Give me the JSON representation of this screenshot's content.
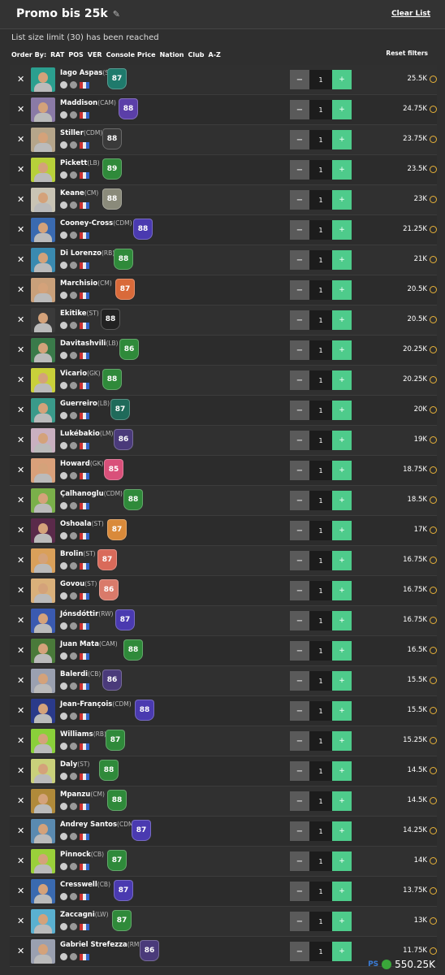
{
  "header": {
    "title": "Promo bis 25k",
    "clear_label": "Clear List"
  },
  "limit_text": "List size limit (30) has been reached",
  "order": {
    "label": "Order By:",
    "options": [
      "RAT",
      "POS",
      "VER",
      "Console Price",
      "Nation",
      "Club",
      "A-Z"
    ],
    "reset_label": "Reset filters"
  },
  "colors": {
    "plus": "#4ecb8b",
    "minus": "#5a5a5a",
    "coin": "#e8b33a"
  },
  "players": [
    {
      "name": "Iago Aspas",
      "pos": "(ST)",
      "rating": "87",
      "qty": "1",
      "price": "25.5K",
      "card": "#1f7a6c",
      "photo": "#2b9f8f"
    },
    {
      "name": "Maddison",
      "pos": "(CAM)",
      "rating": "88",
      "qty": "1",
      "price": "24.75K",
      "card": "#5b3fa8",
      "photo": "#8a7aa6"
    },
    {
      "name": "Stiller",
      "pos": "(CDM)",
      "rating": "88",
      "qty": "1",
      "price": "23.75K",
      "card": "#3a3a3a",
      "photo": "#b5a58a"
    },
    {
      "name": "Pickett",
      "pos": "(LB)",
      "rating": "89",
      "qty": "1",
      "price": "23.5K",
      "card": "#2f8a3a",
      "photo": "#b7d03a"
    },
    {
      "name": "Keane",
      "pos": "(CM)",
      "rating": "88",
      "qty": "1",
      "price": "23K",
      "card": "#8a8a7a",
      "photo": "#c9c4b4"
    },
    {
      "name": "Cooney-Cross",
      "pos": "(CDM)",
      "rating": "88",
      "qty": "1",
      "price": "21.25K",
      "card": "#4a3ab0",
      "photo": "#3a6ab0"
    },
    {
      "name": "Di Lorenzo",
      "pos": "(RB)",
      "rating": "88",
      "qty": "1",
      "price": "21K",
      "card": "#2f8a3a",
      "photo": "#3a8ab0"
    },
    {
      "name": "Marchisio",
      "pos": "(CM)",
      "rating": "87",
      "qty": "1",
      "price": "20.5K",
      "card": "#d96a3a",
      "photo": "#c9a07a"
    },
    {
      "name": "Ekitike",
      "pos": "(ST)",
      "rating": "88",
      "qty": "1",
      "price": "20.5K",
      "card": "#222",
      "photo": "#3a3a3a"
    },
    {
      "name": "Davitashvili",
      "pos": "(LB)",
      "rating": "86",
      "qty": "1",
      "price": "20.25K",
      "card": "#2f8a3a",
      "photo": "#3a7a4a"
    },
    {
      "name": "Vicario",
      "pos": "(GK)",
      "rating": "88",
      "qty": "1",
      "price": "20.25K",
      "card": "#2f8a3a",
      "photo": "#c9d03a"
    },
    {
      "name": "Guerreiro",
      "pos": "(LB)",
      "rating": "87",
      "qty": "1",
      "price": "20K",
      "card": "#1f6a5a",
      "photo": "#3a9a8a"
    },
    {
      "name": "Lukébakio",
      "pos": "(LM)",
      "rating": "86",
      "qty": "1",
      "price": "19K",
      "card": "#4a3a7a",
      "photo": "#c9b0c0"
    },
    {
      "name": "Howard",
      "pos": "(GK)",
      "rating": "85",
      "qty": "1",
      "price": "18.75K",
      "card": "#d9507a",
      "photo": "#d9a07a"
    },
    {
      "name": "Çalhanoglu",
      "pos": "(CDM)",
      "rating": "88",
      "qty": "1",
      "price": "18.5K",
      "card": "#2f8a3a",
      "photo": "#7ab04a"
    },
    {
      "name": "Oshoala",
      "pos": "(ST)",
      "rating": "87",
      "qty": "1",
      "price": "17K",
      "card": "#d98a3a",
      "photo": "#5a2a4a"
    },
    {
      "name": "Brolin",
      "pos": "(ST)",
      "rating": "87",
      "qty": "1",
      "price": "16.75K",
      "card": "#d96a5a",
      "photo": "#d9a05a"
    },
    {
      "name": "Govou",
      "pos": "(ST)",
      "rating": "86",
      "qty": "1",
      "price": "16.75K",
      "card": "#d97a6a",
      "photo": "#d9b07a"
    },
    {
      "name": "Jónsdóttir",
      "pos": "(RW)",
      "rating": "87",
      "qty": "1",
      "price": "16.75K",
      "card": "#4a3ab0",
      "photo": "#3a5ab0"
    },
    {
      "name": "Juan Mata",
      "pos": "(CAM)",
      "rating": "88",
      "qty": "1",
      "price": "16.5K",
      "card": "#2f8a3a",
      "photo": "#4a7a3a"
    },
    {
      "name": "Balerdi",
      "pos": "(CB)",
      "rating": "86",
      "qty": "1",
      "price": "15.5K",
      "card": "#4a3a7a",
      "photo": "#9aa0b0"
    },
    {
      "name": "Jean-François",
      "pos": "(CDM)",
      "rating": "88",
      "qty": "1",
      "price": "15.5K",
      "card": "#4a3ab0",
      "photo": "#2a3a8a"
    },
    {
      "name": "Williams",
      "pos": "(RB)",
      "rating": "87",
      "qty": "1",
      "price": "15.25K",
      "card": "#2f8a3a",
      "photo": "#8ad03a"
    },
    {
      "name": "Daly",
      "pos": "(ST)",
      "rating": "88",
      "qty": "1",
      "price": "14.5K",
      "card": "#2f8a3a",
      "photo": "#c9d07a"
    },
    {
      "name": "Mpanzu",
      "pos": "(CM)",
      "rating": "88",
      "qty": "1",
      "price": "14.5K",
      "card": "#2f8a3a",
      "photo": "#b08a3a"
    },
    {
      "name": "Andrey Santos",
      "pos": "(CDM)",
      "rating": "87",
      "qty": "1",
      "price": "14.25K",
      "card": "#4a3ab0",
      "photo": "#5a8ab0"
    },
    {
      "name": "Pinnock",
      "pos": "(CB)",
      "rating": "87",
      "qty": "1",
      "price": "14K",
      "card": "#2f8a3a",
      "photo": "#9ad03a"
    },
    {
      "name": "Cresswell",
      "pos": "(CB)",
      "rating": "87",
      "qty": "1",
      "price": "13.75K",
      "card": "#4a3ab0",
      "photo": "#3a6ab0"
    },
    {
      "name": "Zaccagni",
      "pos": "(LW)",
      "rating": "87",
      "qty": "1",
      "price": "13K",
      "card": "#2f8a3a",
      "photo": "#5ab0d0"
    },
    {
      "name": "Gabriel Strefezza",
      "pos": "(RM)",
      "rating": "86",
      "qty": "1",
      "price": "11.75K",
      "card": "#4a3a7a",
      "photo": "#9aa0b0"
    }
  ],
  "total": {
    "value": "550.25K",
    "platform": "PS"
  }
}
